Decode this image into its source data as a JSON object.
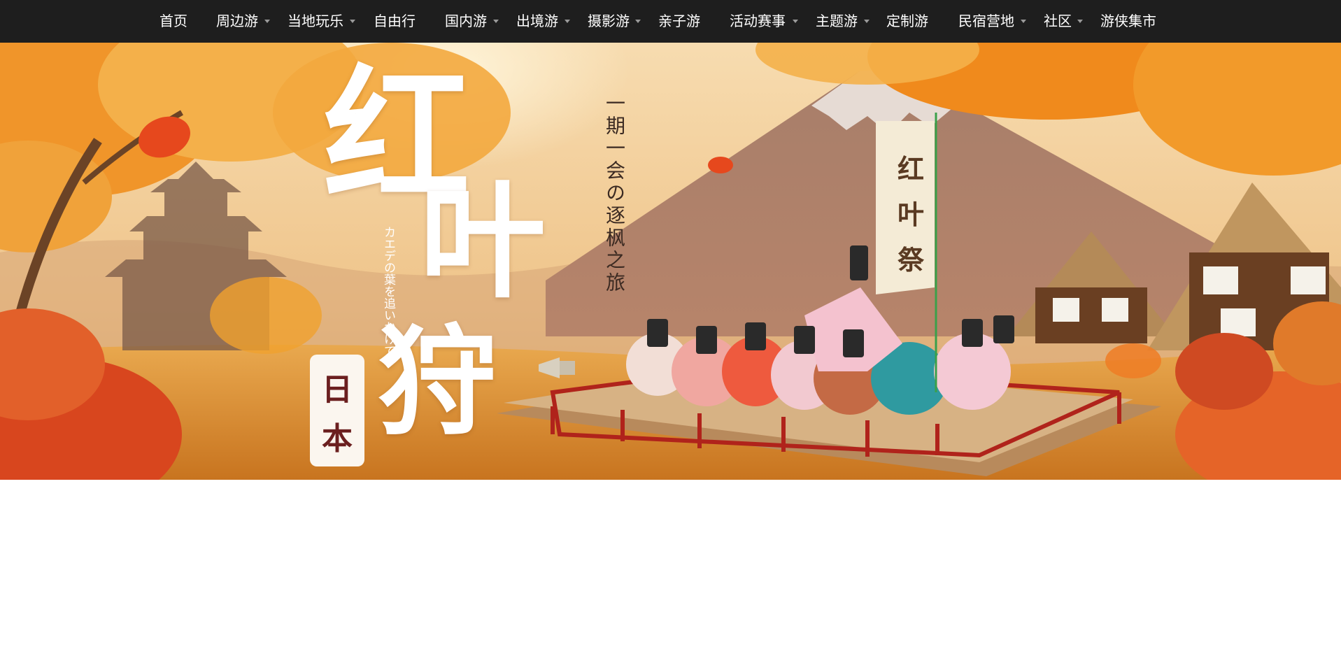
{
  "nav": {
    "items": [
      {
        "label": "首页",
        "has_dropdown": false
      },
      {
        "label": "周边游",
        "has_dropdown": true
      },
      {
        "label": "当地玩乐",
        "has_dropdown": true
      },
      {
        "label": "自由行",
        "has_dropdown": false
      },
      {
        "label": "国内游",
        "has_dropdown": true
      },
      {
        "label": "出境游",
        "has_dropdown": true
      },
      {
        "label": "摄影游",
        "has_dropdown": true
      },
      {
        "label": "亲子游",
        "has_dropdown": false
      },
      {
        "label": "活动赛事",
        "has_dropdown": true
      },
      {
        "label": "主题游",
        "has_dropdown": true
      },
      {
        "label": "定制游",
        "has_dropdown": false
      },
      {
        "label": "民宿营地",
        "has_dropdown": true
      },
      {
        "label": "社区",
        "has_dropdown": true
      },
      {
        "label": "游侠集市",
        "has_dropdown": false
      }
    ],
    "dropdown_icon": "caret-down-icon",
    "colors": {
      "background": "#1e1e1e",
      "text": "#ffffff",
      "caret": "#9a9a9a"
    }
  },
  "banner": {
    "title_chars": [
      "红",
      "叶",
      "狩"
    ],
    "badge_chars": [
      "日",
      "本"
    ],
    "tagline": "一期一会の逐枫之旅",
    "japanese_subtitle": [
      "カエデの葉",
      "を追いかけて"
    ],
    "flag_chars": [
      "红",
      "叶",
      "祭"
    ],
    "colors": {
      "sky": "#f2c98f",
      "ground": "#d98a2e",
      "leaves": "#f08a1c",
      "badge_text": "#6b1f1f"
    }
  }
}
